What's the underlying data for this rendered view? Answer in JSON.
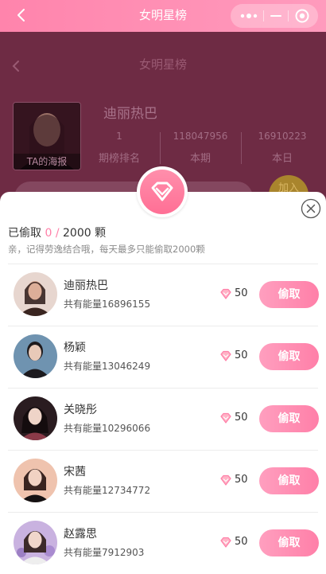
{
  "window": {
    "title": "女明星榜"
  },
  "page": {
    "title": "女明星榜"
  },
  "star": {
    "name": "迪丽热巴",
    "poster_label": "TA的海报",
    "stats": [
      {
        "value": "1",
        "label": "期榜排名"
      },
      {
        "value": "118047956",
        "label": "本期"
      },
      {
        "value": "16910223",
        "label": "本日"
      }
    ],
    "join_label": "加入"
  },
  "modal": {
    "stolen_label": "已偷取",
    "stolen_count": "0",
    "separator": "/",
    "limit": "2000 颗",
    "hint": "亲，记得劳逸结合哦，每天最多只能偷取2000颗",
    "rows": [
      {
        "name": "迪丽热巴",
        "energy": "共有能量16896155",
        "count": "50",
        "button": "偷取",
        "avatar_color": "#caa08d"
      },
      {
        "name": "杨颖",
        "energy": "共有能量13046249",
        "count": "50",
        "button": "偷取",
        "avatar_color": "#7195b2"
      },
      {
        "name": "关晓彤",
        "energy": "共有能量10296066",
        "count": "50",
        "button": "偷取",
        "avatar_color": "#5a3a40"
      },
      {
        "name": "宋茜",
        "energy": "共有能量12734772",
        "count": "50",
        "button": "偷取",
        "avatar_color": "#e8b9a6"
      },
      {
        "name": "赵露思",
        "energy": "共有能量7912903",
        "count": "50",
        "button": "偷取",
        "avatar_color": "#bca2d6"
      }
    ]
  },
  "colors": {
    "accent": "#ff7fa8",
    "header": "#ff8cb1",
    "overlay": "#6e2b44"
  }
}
